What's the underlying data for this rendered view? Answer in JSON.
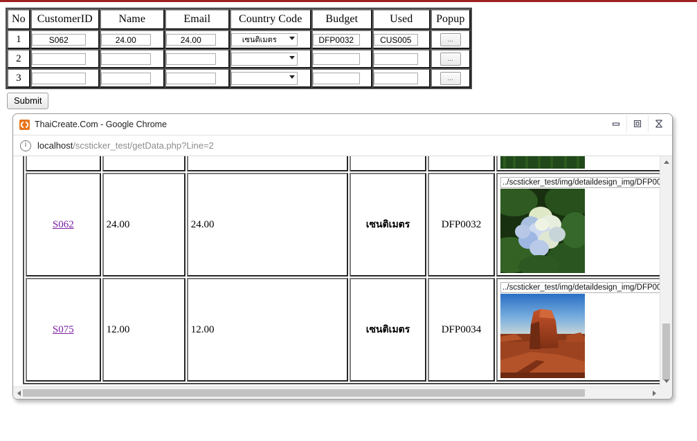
{
  "page": {
    "accent_rule_color": "#9e2020"
  },
  "form": {
    "headers": [
      "No",
      "CustomerID",
      "Name",
      "Email",
      "Country Code",
      "Budget",
      "Used",
      "Popup"
    ],
    "rows": [
      {
        "no": "1",
        "customer_id": "S062",
        "name": "24.00",
        "email": "24.00",
        "country_code": "เซนติเมตร",
        "budget": "DFP0032",
        "used": "CUS005",
        "popup_label": "..."
      },
      {
        "no": "2",
        "customer_id": "",
        "name": "",
        "email": "",
        "country_code": "",
        "budget": "",
        "used": "",
        "popup_label": "..."
      },
      {
        "no": "3",
        "customer_id": "",
        "name": "",
        "email": "",
        "country_code": "",
        "budget": "",
        "used": "",
        "popup_label": "..."
      }
    ],
    "submit_label": "Submit"
  },
  "window": {
    "title": "ThaiCreate.Com - Google Chrome",
    "icon": "chrome-icon",
    "controls": {
      "minimize": "minimize-icon",
      "restore": "restore-icon",
      "close": "close-icon"
    },
    "url": {
      "host": "localhost",
      "path": "/scsticker_test/getData.php?Line=2",
      "info_icon": "info-circle-icon"
    }
  },
  "data_table": {
    "rows": [
      {
        "id": "",
        "value1": "",
        "value2": "",
        "unit": "",
        "code": "",
        "image_path": "",
        "image_kind": "yellow-tulips",
        "partial": true
      },
      {
        "id": "S062",
        "value1": "24.00",
        "value2": "24.00",
        "unit": "เซนติเมตร",
        "code": "DFP0032",
        "image_path": "../scsticker_test/img/detaildesign_img/DFP0032.jpg",
        "image_kind": "blue-hydrangea",
        "partial": false
      },
      {
        "id": "S075",
        "value1": "12.00",
        "value2": "12.00",
        "unit": "เซนติเมตร",
        "code": "DFP0034",
        "image_path": "../scsticker_test/img/detaildesign_img/DFP0034.jpg",
        "image_kind": "red-desert-butte",
        "partial": false
      }
    ]
  }
}
